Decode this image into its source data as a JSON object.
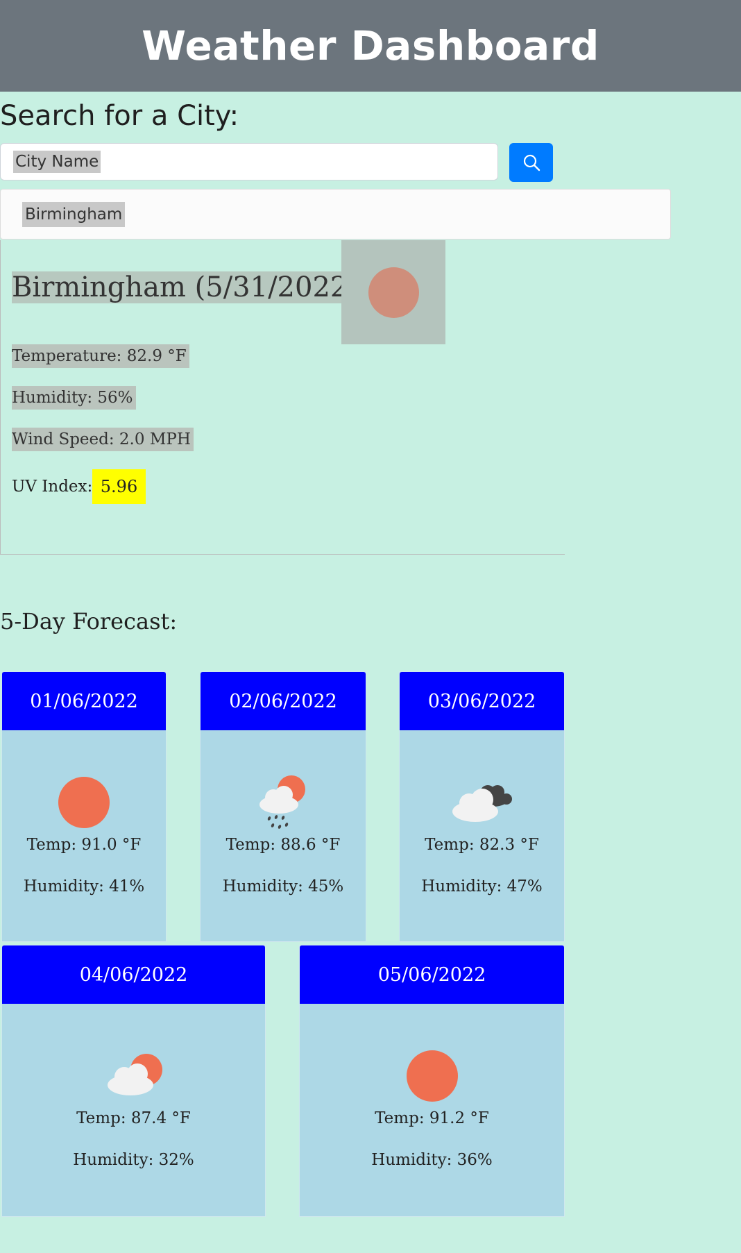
{
  "header": {
    "title": "Weather Dashboard"
  },
  "search": {
    "heading": "Search for a City:",
    "placeholder": "City Name",
    "button_icon": "search-icon"
  },
  "history": [
    "Birmingham"
  ],
  "current": {
    "title": "Birmingham (5/31/2022)",
    "icon": "sun-icon",
    "temperature": "Temperature: 82.9 °F",
    "humidity": "Humidity: 56%",
    "wind": "Wind Speed: 2.0 MPH",
    "uv_label": "UV Index:",
    "uv_value": "5.96",
    "uv_color": "#ffff00"
  },
  "forecast": {
    "title": "5-Day Forecast:",
    "days": [
      {
        "date": "01/06/2022",
        "icon": "sun-icon",
        "temp": "Temp: 91.0 °F",
        "humidity": "Humidity: 41%"
      },
      {
        "date": "02/06/2022",
        "icon": "rain-sun-icon",
        "temp": "Temp: 88.6 °F",
        "humidity": "Humidity: 45%"
      },
      {
        "date": "03/06/2022",
        "icon": "dark-clouds-icon",
        "temp": "Temp: 82.3 °F",
        "humidity": "Humidity: 47%"
      },
      {
        "date": "04/06/2022",
        "icon": "partly-cloudy-icon",
        "temp": "Temp: 87.4 °F",
        "humidity": "Humidity: 32%"
      },
      {
        "date": "05/06/2022",
        "icon": "sun-icon",
        "temp": "Temp: 91.2 °F",
        "humidity": "Humidity: 36%"
      }
    ]
  },
  "colors": {
    "header_bg": "#6c757d",
    "page_bg": "#c7f0e2",
    "card_header": "#0000ff",
    "card_body": "#add8e6",
    "button": "#007bff"
  }
}
